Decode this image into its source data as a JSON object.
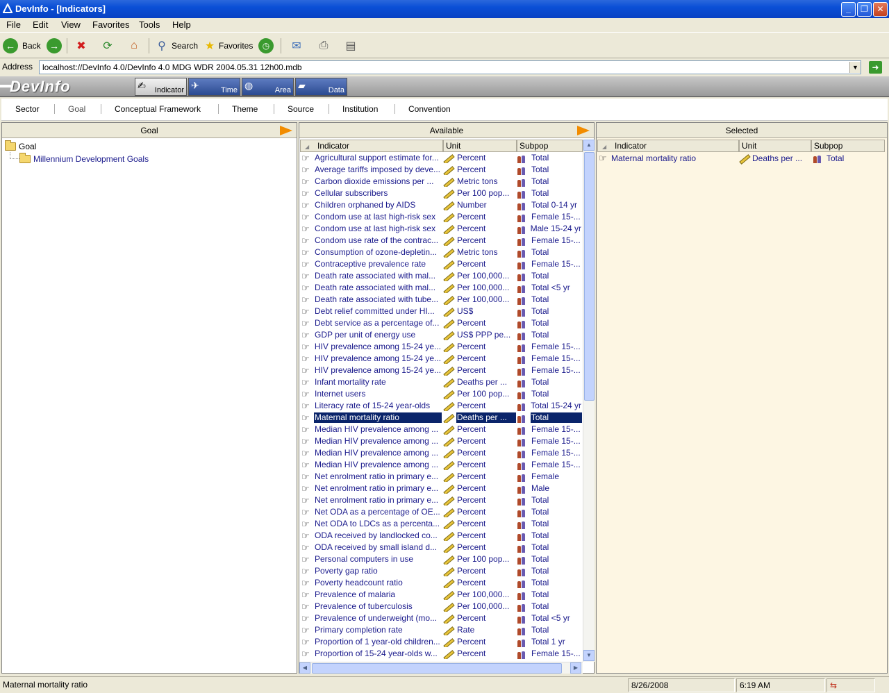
{
  "window": {
    "title": "DevInfo - [Indicators]",
    "minimize": "_",
    "maximize": "❐",
    "close": "✕"
  },
  "menu": [
    "File",
    "Edit",
    "View",
    "Favorites",
    "Tools",
    "Help"
  ],
  "toolbar": {
    "back": "Back",
    "search": "Search",
    "favorites": "Favorites"
  },
  "address": {
    "label": "Address",
    "value": "localhost://DevInfo 4.0/DevInfo 4.0 MDG WDR 2004.05.31 12h00.mdb"
  },
  "banner": {
    "logo": "DevInfo",
    "tabs": [
      "Indicator",
      "Time",
      "Area",
      "Data"
    ],
    "active_tab": "Indicator"
  },
  "subtabs": [
    "Sector",
    "Goal",
    "Conceptual Framework",
    "Theme",
    "Source",
    "Institution",
    "Convention"
  ],
  "goal_panel": {
    "header": "Goal",
    "root": "Goal",
    "child": "Millennium Development Goals"
  },
  "available_panel": {
    "header": "Available",
    "columns": [
      "Indicator",
      "Unit",
      "Subpop"
    ],
    "rows": [
      [
        "Agricultural support estimate for...",
        "Percent",
        "Total"
      ],
      [
        "Average tariffs imposed by deve...",
        "Percent",
        "Total"
      ],
      [
        "Carbon dioxide emissions per ...",
        "Metric tons",
        "Total"
      ],
      [
        "Cellular subscribers",
        "Per 100 pop...",
        "Total"
      ],
      [
        "Children orphaned by AIDS",
        "Number",
        "Total 0-14 yr"
      ],
      [
        "Condom use at last high-risk sex",
        "Percent",
        "Female 15-..."
      ],
      [
        "Condom use at last high-risk sex",
        "Percent",
        "Male 15-24 yr"
      ],
      [
        "Condom use rate of the contrac...",
        "Percent",
        "Female 15-..."
      ],
      [
        "Consumption of ozone-depletin...",
        "Metric tons",
        "Total"
      ],
      [
        "Contraceptive prevalence rate",
        "Percent",
        "Female 15-..."
      ],
      [
        "Death rate associated with mal...",
        "Per 100,000...",
        "Total"
      ],
      [
        "Death rate associated with mal...",
        "Per 100,000...",
        "Total <5 yr"
      ],
      [
        "Death rate associated with tube...",
        "Per 100,000...",
        "Total"
      ],
      [
        "Debt relief committed under HI...",
        "US$",
        "Total"
      ],
      [
        "Debt service as a percentage of...",
        "Percent",
        "Total"
      ],
      [
        "GDP per unit of energy use",
        "US$ PPP pe...",
        "Total"
      ],
      [
        "HIV prevalence among 15-24 ye...",
        "Percent",
        "Female 15-..."
      ],
      [
        "HIV prevalence among 15-24 ye...",
        "Percent",
        "Female 15-..."
      ],
      [
        "HIV prevalence among 15-24 ye...",
        "Percent",
        "Female 15-..."
      ],
      [
        "Infant mortality rate",
        "Deaths per ...",
        "Total"
      ],
      [
        "Internet users",
        "Per 100 pop...",
        "Total"
      ],
      [
        "Literacy rate of 15-24 year-olds",
        "Percent",
        "Total 15-24 yr"
      ],
      [
        "Maternal mortality ratio",
        "Deaths per ...",
        "Total"
      ],
      [
        "Median HIV prevalence among ...",
        "Percent",
        "Female 15-..."
      ],
      [
        "Median HIV prevalence among ...",
        "Percent",
        "Female 15-..."
      ],
      [
        "Median HIV prevalence among ...",
        "Percent",
        "Female 15-..."
      ],
      [
        "Median HIV prevalence among ...",
        "Percent",
        "Female 15-..."
      ],
      [
        "Net enrolment ratio in primary e...",
        "Percent",
        "Female"
      ],
      [
        "Net enrolment ratio in primary e...",
        "Percent",
        "Male"
      ],
      [
        "Net enrolment ratio in primary e...",
        "Percent",
        "Total"
      ],
      [
        "Net ODA as a percentage of OE...",
        "Percent",
        "Total"
      ],
      [
        "Net ODA to LDCs as a percenta...",
        "Percent",
        "Total"
      ],
      [
        "ODA received by landlocked co...",
        "Percent",
        "Total"
      ],
      [
        "ODA received by small island d...",
        "Percent",
        "Total"
      ],
      [
        "Personal computers in use",
        "Per 100 pop...",
        "Total"
      ],
      [
        "Poverty gap ratio",
        "Percent",
        "Total"
      ],
      [
        "Poverty headcount ratio",
        "Percent",
        "Total"
      ],
      [
        "Prevalence of malaria",
        "Per 100,000...",
        "Total"
      ],
      [
        "Prevalence of tuberculosis",
        "Per 100,000...",
        "Total"
      ],
      [
        "Prevalence of underweight (mo...",
        "Percent",
        "Total <5 yr"
      ],
      [
        "Primary completion rate",
        "Rate",
        "Total"
      ],
      [
        "Proportion of 1 year-old children...",
        "Percent",
        "Total 1 yr"
      ],
      [
        "Proportion of 15-24 year-olds w...",
        "Percent",
        "Female 15-..."
      ]
    ],
    "selected_index": 22
  },
  "selected_panel": {
    "header": "Selected",
    "columns": [
      "Indicator",
      "Unit",
      "Subpop"
    ],
    "rows": [
      [
        "Maternal mortality ratio",
        "Deaths per ...",
        "Total"
      ]
    ]
  },
  "status": {
    "message": "Maternal mortality ratio",
    "date": "8/26/2008",
    "time": "6:19 AM"
  },
  "colors": {
    "title_bar": "#0a4fd6",
    "selection": "#0a246a",
    "link_text": "#1a1a8c",
    "arrow": "#f28c00"
  }
}
